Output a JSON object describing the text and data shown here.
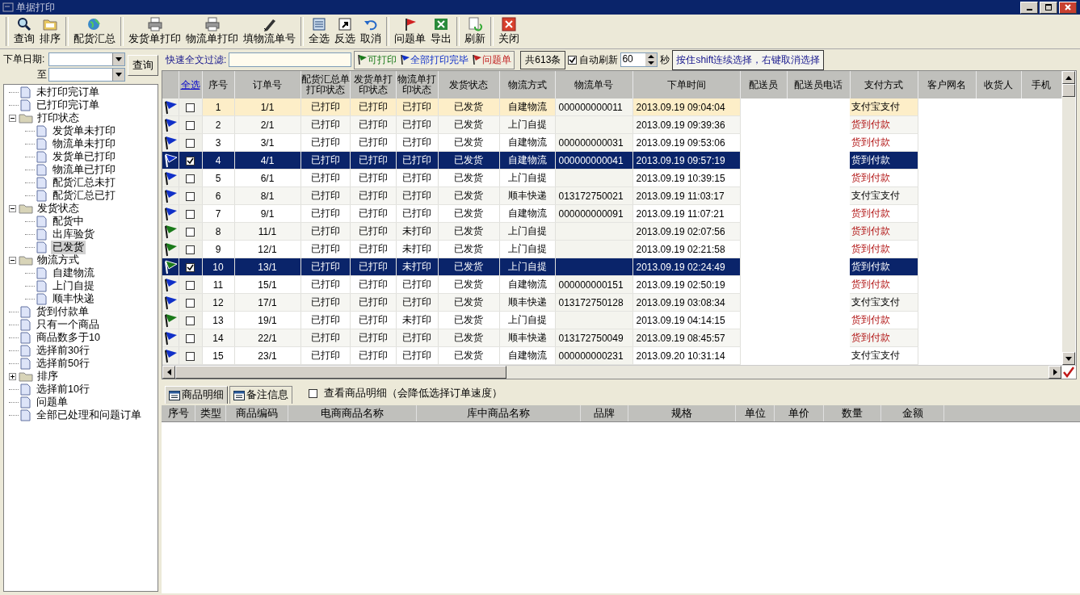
{
  "window": {
    "title": "单据打印"
  },
  "toolbar": [
    [
      "查询",
      "排序"
    ],
    [
      "配货汇总"
    ],
    [
      "发货单打印",
      "物流单打印",
      "填物流单号"
    ],
    [
      "全选",
      "反选",
      "取消"
    ],
    [
      "问题单",
      "导出"
    ],
    [
      "刷新"
    ],
    [
      "关闭"
    ]
  ],
  "date_filter": {
    "from_label": "下单日期:",
    "to_label": "至",
    "button": "查询"
  },
  "tree": [
    {
      "label": "未打印完订单",
      "kind": "doc",
      "selected": false
    },
    {
      "label": "已打印完订单",
      "kind": "doc",
      "selected": false
    },
    {
      "label": "打印状态",
      "kind": "folder",
      "selected": false,
      "expanded": true,
      "children": [
        {
          "label": "发货单未打印",
          "kind": "doc",
          "selected": false
        },
        {
          "label": "物流单未打印",
          "kind": "doc",
          "selected": false
        },
        {
          "label": "发货单已打印",
          "kind": "doc",
          "selected": false
        },
        {
          "label": "物流单已打印",
          "kind": "doc",
          "selected": false
        },
        {
          "label": "配货汇总未打",
          "kind": "doc",
          "selected": false
        },
        {
          "label": "配货汇总已打",
          "kind": "doc",
          "selected": false
        }
      ]
    },
    {
      "label": "发货状态",
      "kind": "folder",
      "selected": false,
      "expanded": true,
      "children": [
        {
          "label": "配货中",
          "kind": "doc",
          "selected": false
        },
        {
          "label": "出库验货",
          "kind": "doc",
          "selected": false
        },
        {
          "label": "已发货",
          "kind": "doc",
          "selected": true
        }
      ]
    },
    {
      "label": "物流方式",
      "kind": "folder",
      "selected": false,
      "expanded": true,
      "children": [
        {
          "label": "自建物流",
          "kind": "doc",
          "selected": false
        },
        {
          "label": "上门自提",
          "kind": "doc",
          "selected": false
        },
        {
          "label": "顺丰快递",
          "kind": "doc",
          "selected": false
        }
      ]
    },
    {
      "label": "货到付款单",
      "kind": "doc",
      "selected": false
    },
    {
      "label": "只有一个商品",
      "kind": "doc",
      "selected": false
    },
    {
      "label": "商品数多于10",
      "kind": "doc",
      "selected": false
    },
    {
      "label": "选择前30行",
      "kind": "doc",
      "selected": false
    },
    {
      "label": "选择前50行",
      "kind": "doc",
      "selected": false
    },
    {
      "label": "排序",
      "kind": "folder",
      "selected": false,
      "expanded": false
    },
    {
      "label": "选择前10行",
      "kind": "doc",
      "selected": false
    },
    {
      "label": "问题单",
      "kind": "doc",
      "selected": false
    },
    {
      "label": "全部已处理和问题订单",
      "kind": "doc",
      "selected": false
    }
  ],
  "filter_bar": {
    "label": "快速全文过滤:",
    "legend": [
      {
        "label": "可打印",
        "color": "#1a7a1a"
      },
      {
        "label": "全部打印完毕",
        "color": "#1030c8"
      },
      {
        "label": "问题单",
        "color": "#c02020"
      }
    ],
    "count": "共613条",
    "auto_refresh": {
      "label": "自动刷新",
      "checked": true,
      "value": "60",
      "unit": "秒"
    },
    "hint": "按住shift连续选择，右键取消选择"
  },
  "table": {
    "select_all": "全选",
    "columns": [
      {
        "label": "序号"
      },
      {
        "label": "订单号"
      },
      {
        "label": "配货汇总单打印状态"
      },
      {
        "label": "发货单打印状态"
      },
      {
        "label": "物流单打印状态"
      },
      {
        "label": "发货状态"
      },
      {
        "label": "物流方式"
      },
      {
        "label": "物流单号"
      },
      {
        "label": "下单时间"
      },
      {
        "label": "配送员"
      },
      {
        "label": "配送员电话"
      },
      {
        "label": "支付方式"
      },
      {
        "label": "客户网名"
      },
      {
        "label": "收货人"
      },
      {
        "label": "手机"
      }
    ],
    "rows": [
      {
        "flag": {
          "color": "#1030c8"
        },
        "checked": false,
        "selected": false,
        "focused": true,
        "cells": [
          "1",
          "1/1",
          "已打印",
          "已打印",
          "已打印",
          "已发货",
          "自建物流",
          "000000000011",
          "2013.09.19 09:04:04"
        ],
        "payment": {
          "text": "支付宝支付",
          "kind": "online"
        }
      },
      {
        "flag": {
          "color": "#1030c8"
        },
        "checked": false,
        "selected": false,
        "focused": false,
        "cells": [
          "2",
          "2/1",
          "已打印",
          "已打印",
          "已打印",
          "已发货",
          "上门自提",
          "",
          "2013.09.19 09:39:36"
        ],
        "payment": {
          "text": "货到付款",
          "kind": "cod"
        }
      },
      {
        "flag": {
          "color": "#1030c8"
        },
        "checked": false,
        "selected": false,
        "focused": false,
        "cells": [
          "3",
          "3/1",
          "已打印",
          "已打印",
          "已打印",
          "已发货",
          "自建物流",
          "000000000031",
          "2013.09.19 09:53:06"
        ],
        "payment": {
          "text": "货到付款",
          "kind": "cod"
        }
      },
      {
        "flag": {
          "color": "#1030c8"
        },
        "checked": true,
        "selected": true,
        "focused": false,
        "cells": [
          "4",
          "4/1",
          "已打印",
          "已打印",
          "已打印",
          "已发货",
          "自建物流",
          "000000000041",
          "2013.09.19 09:57:19"
        ],
        "payment": {
          "text": "货到付款",
          "kind": "cod"
        }
      },
      {
        "flag": {
          "color": "#1030c8"
        },
        "checked": false,
        "selected": false,
        "focused": false,
        "cells": [
          "5",
          "6/1",
          "已打印",
          "已打印",
          "已打印",
          "已发货",
          "上门自提",
          "",
          "2013.09.19 10:39:15"
        ],
        "payment": {
          "text": "货到付款",
          "kind": "cod"
        }
      },
      {
        "flag": {
          "color": "#1030c8"
        },
        "checked": false,
        "selected": false,
        "focused": false,
        "cells": [
          "6",
          "8/1",
          "已打印",
          "已打印",
          "已打印",
          "已发货",
          "顺丰快递",
          "013172750021",
          "2013.09.19 11:03:17"
        ],
        "payment": {
          "text": "支付宝支付",
          "kind": "online"
        }
      },
      {
        "flag": {
          "color": "#1030c8"
        },
        "checked": false,
        "selected": false,
        "focused": false,
        "cells": [
          "7",
          "9/1",
          "已打印",
          "已打印",
          "已打印",
          "已发货",
          "自建物流",
          "000000000091",
          "2013.09.19 11:07:21"
        ],
        "payment": {
          "text": "货到付款",
          "kind": "cod"
        }
      },
      {
        "flag": {
          "color": "#1a7a1a"
        },
        "checked": false,
        "selected": false,
        "focused": false,
        "cells": [
          "8",
          "11/1",
          "已打印",
          "已打印",
          "未打印",
          "已发货",
          "上门自提",
          "",
          "2013.09.19 02:07:56"
        ],
        "payment": {
          "text": "货到付款",
          "kind": "cod"
        }
      },
      {
        "flag": {
          "color": "#1a7a1a"
        },
        "checked": false,
        "selected": false,
        "focused": false,
        "cells": [
          "9",
          "12/1",
          "已打印",
          "已打印",
          "未打印",
          "已发货",
          "上门自提",
          "",
          "2013.09.19 02:21:58"
        ],
        "payment": {
          "text": "货到付款",
          "kind": "cod"
        }
      },
      {
        "flag": {
          "color": "#1a7a1a"
        },
        "checked": true,
        "selected": true,
        "focused": false,
        "cells": [
          "10",
          "13/1",
          "已打印",
          "已打印",
          "未打印",
          "已发货",
          "上门自提",
          "",
          "2013.09.19 02:24:49"
        ],
        "payment": {
          "text": "货到付款",
          "kind": "cod"
        }
      },
      {
        "flag": {
          "color": "#1030c8"
        },
        "checked": false,
        "selected": false,
        "focused": false,
        "cells": [
          "11",
          "15/1",
          "已打印",
          "已打印",
          "已打印",
          "已发货",
          "自建物流",
          "000000000151",
          "2013.09.19 02:50:19"
        ],
        "payment": {
          "text": "货到付款",
          "kind": "cod"
        }
      },
      {
        "flag": {
          "color": "#1030c8"
        },
        "checked": false,
        "selected": false,
        "focused": false,
        "cells": [
          "12",
          "17/1",
          "已打印",
          "已打印",
          "已打印",
          "已发货",
          "顺丰快递",
          "013172750128",
          "2013.09.19 03:08:34"
        ],
        "payment": {
          "text": "支付宝支付",
          "kind": "online"
        }
      },
      {
        "flag": {
          "color": "#1a7a1a"
        },
        "checked": false,
        "selected": false,
        "focused": false,
        "cells": [
          "13",
          "19/1",
          "已打印",
          "已打印",
          "未打印",
          "已发货",
          "上门自提",
          "",
          "2013.09.19 04:14:15"
        ],
        "payment": {
          "text": "货到付款",
          "kind": "cod"
        }
      },
      {
        "flag": {
          "color": "#1030c8"
        },
        "checked": false,
        "selected": false,
        "focused": false,
        "cells": [
          "14",
          "22/1",
          "已打印",
          "已打印",
          "已打印",
          "已发货",
          "顺丰快递",
          "013172750049",
          "2013.09.19 08:45:57"
        ],
        "payment": {
          "text": "货到付款",
          "kind": "cod"
        }
      },
      {
        "flag": {
          "color": "#1030c8"
        },
        "checked": false,
        "selected": false,
        "focused": false,
        "cells": [
          "15",
          "23/1",
          "已打印",
          "已打印",
          "已打印",
          "已发货",
          "自建物流",
          "000000000231",
          "2013.09.20 10:31:14"
        ],
        "payment": {
          "text": "支付宝支付",
          "kind": "online"
        }
      }
    ]
  },
  "detail": {
    "tabs": [
      {
        "label": "商品明细",
        "selected": true
      },
      {
        "label": "备注信息",
        "selected": false
      }
    ],
    "show_detail": {
      "label": "查看商品明细（会降低选择订单速度）",
      "checked": false
    },
    "columns": [
      "序号",
      "类型",
      "商品编码",
      "电商商品名称",
      "库中商品名称",
      "品牌",
      "规格",
      "单位",
      "单价",
      "数量",
      "金额"
    ]
  }
}
